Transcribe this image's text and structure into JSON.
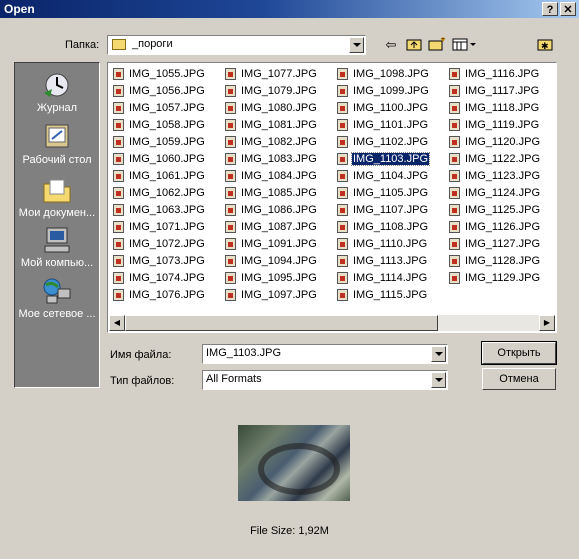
{
  "window": {
    "title": "Open",
    "help_label": "?",
    "close_label": "✕"
  },
  "folder": {
    "label": "Папка:",
    "value": "_пороги"
  },
  "toolbar": {
    "back_icon": "back-arrow-icon",
    "up_icon": "up-folder-icon",
    "new_folder_icon": "new-folder-icon",
    "view_icon": "view-menu-icon",
    "extra_icon": "favorites-icon"
  },
  "places": [
    {
      "label": "Журнал",
      "icon": "history-icon"
    },
    {
      "label": "Рабочий стол",
      "icon": "desktop-icon"
    },
    {
      "label": "Мои докумен...",
      "icon": "my-documents-icon"
    },
    {
      "label": "Мой компью...",
      "icon": "my-computer-icon"
    },
    {
      "label": "Мое сетевое ...",
      "icon": "network-icon"
    }
  ],
  "files": [
    [
      "IMG_1055.JPG",
      "IMG_1056.JPG",
      "IMG_1057.JPG",
      "IMG_1058.JPG",
      "IMG_1059.JPG",
      "IMG_1060.JPG",
      "IMG_1061.JPG",
      "IMG_1062.JPG",
      "IMG_1063.JPG",
      "IMG_1071.JPG",
      "IMG_1072.JPG",
      "IMG_1073.JPG",
      "IMG_1074.JPG",
      "IMG_1076.JPG"
    ],
    [
      "IMG_1077.JPG",
      "IMG_1079.JPG",
      "IMG_1080.JPG",
      "IMG_1081.JPG",
      "IMG_1082.JPG",
      "IMG_1083.JPG",
      "IMG_1084.JPG",
      "IMG_1085.JPG",
      "IMG_1086.JPG",
      "IMG_1087.JPG",
      "IMG_1091.JPG",
      "IMG_1094.JPG",
      "IMG_1095.JPG",
      "IMG_1097.JPG"
    ],
    [
      "IMG_1098.JPG",
      "IMG_1099.JPG",
      "IMG_1100.JPG",
      "IMG_1101.JPG",
      "IMG_1102.JPG",
      "IMG_1103.JPG",
      "IMG_1104.JPG",
      "IMG_1105.JPG",
      "IMG_1107.JPG",
      "IMG_1108.JPG",
      "IMG_1110.JPG",
      "IMG_1113.JPG",
      "IMG_1114.JPG",
      "IMG_1115.JPG"
    ],
    [
      "IMG_1116.JPG",
      "IMG_1117.JPG",
      "IMG_1118.JPG",
      "IMG_1119.JPG",
      "IMG_1120.JPG",
      "IMG_1122.JPG",
      "IMG_1123.JPG",
      "IMG_1124.JPG",
      "IMG_1125.JPG",
      "IMG_1126.JPG",
      "IMG_1127.JPG",
      "IMG_1128.JPG",
      "IMG_1129.JPG"
    ]
  ],
  "selected_file": "IMG_1103.JPG",
  "filename": {
    "label": "Имя файла:",
    "value": "IMG_1103.JPG"
  },
  "filetype": {
    "label": "Тип файлов:",
    "value": "All Formats"
  },
  "buttons": {
    "open": "Открыть",
    "cancel": "Отмена"
  },
  "preview": {
    "size_text": "File Size: 1,92M"
  }
}
